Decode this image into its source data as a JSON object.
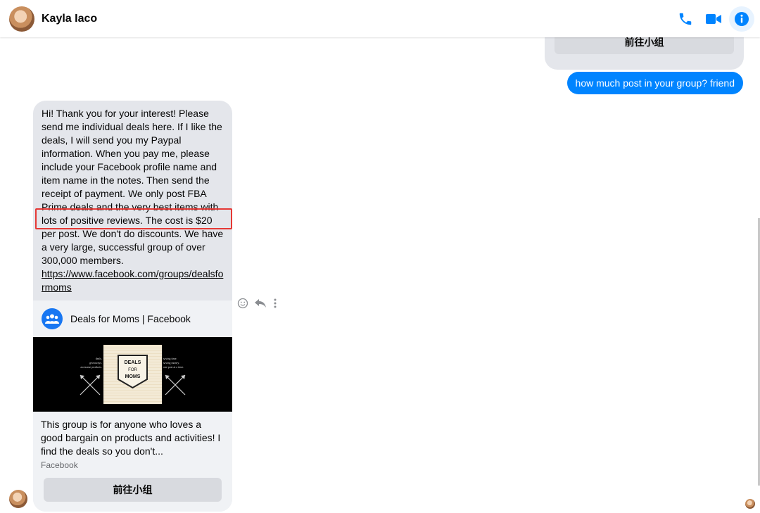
{
  "header": {
    "contact_name": "Kayla Iaco",
    "icons": [
      "phone-icon",
      "video-camera-icon",
      "info-icon"
    ],
    "accent_color": "#0084ff"
  },
  "messages": {
    "previous_card_button": "前往小组",
    "outgoing_text": "how much post in your group? friend",
    "incoming_text": "Hi! Thank you for your interest! Please send me individual deals here. If I like the deals, I will send you my Paypal information. When you pay me, please include your Facebook profile name and item name in the notes. Then send the receipt of payment. We only post FBA Prime deals and the very best items with lots of positive reviews. The cost is $20 per post. We don't do discounts. We have a very large, successful group of over 300,000 members.",
    "incoming_link": "https://www.facebook.com/groups/dealsformoms"
  },
  "link_preview": {
    "title": "Deals for Moms | Facebook",
    "image_logo_lines": [
      "DEALS",
      "FOR",
      "MOMS"
    ],
    "image_left_tagline": [
      "deals.",
      "giveaways.",
      "awesome products."
    ],
    "image_right_tagline": [
      "saving time.",
      "saving money.",
      "one post at a time."
    ],
    "description": "This group is for anyone who loves a good bargain on products and activities! I find the deals so you don't...",
    "source": "Facebook",
    "button_label": "前往小组"
  },
  "message_actions": [
    "react-icon",
    "reply-icon",
    "more-icon"
  ],
  "colors": {
    "highlight": "#e53935",
    "outgoing_bubble": "#0084ff",
    "incoming_bubble": "#e4e6eb"
  }
}
